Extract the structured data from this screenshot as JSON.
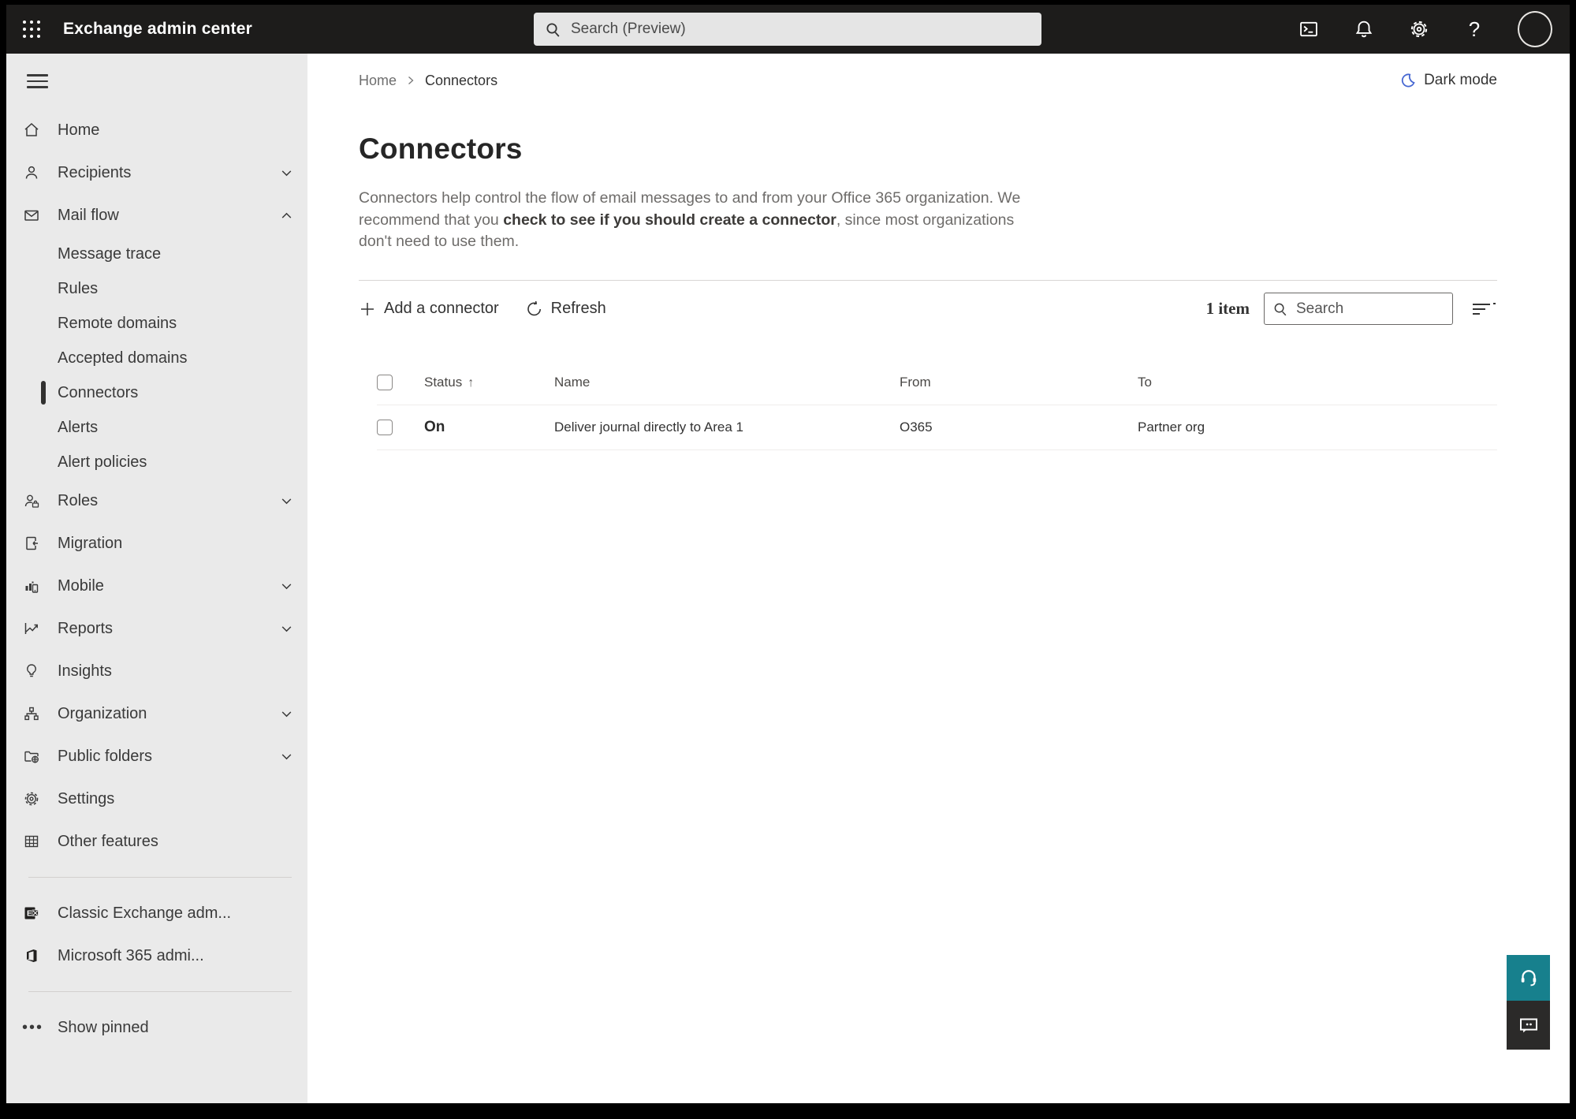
{
  "topbar": {
    "app_title": "Exchange admin center",
    "search_placeholder": "Search (Preview)",
    "icons": [
      "app-launcher-icon",
      "terminal-icon",
      "bell-icon",
      "gear-icon",
      "help-icon",
      "account-avatar"
    ]
  },
  "sidebar": {
    "items": [
      {
        "label": "Home",
        "icon": "home-icon",
        "chevron": "none"
      },
      {
        "label": "Recipients",
        "icon": "person-icon",
        "chevron": "down"
      },
      {
        "label": "Mail flow",
        "icon": "mail-icon",
        "chevron": "up",
        "children": [
          {
            "label": "Message trace"
          },
          {
            "label": "Rules"
          },
          {
            "label": "Remote domains"
          },
          {
            "label": "Accepted domains"
          },
          {
            "label": "Connectors",
            "selected": true
          },
          {
            "label": "Alerts"
          },
          {
            "label": "Alert policies"
          }
        ]
      },
      {
        "label": "Roles",
        "icon": "roles-icon",
        "chevron": "down"
      },
      {
        "label": "Migration",
        "icon": "migration-icon",
        "chevron": "none"
      },
      {
        "label": "Mobile",
        "icon": "mobile-icon",
        "chevron": "down"
      },
      {
        "label": "Reports",
        "icon": "reports-icon",
        "chevron": "down"
      },
      {
        "label": "Insights",
        "icon": "lightbulb-icon",
        "chevron": "none"
      },
      {
        "label": "Organization",
        "icon": "org-chart-icon",
        "chevron": "down"
      },
      {
        "label": "Public folders",
        "icon": "public-folder-icon",
        "chevron": "down"
      },
      {
        "label": "Settings",
        "icon": "gear-icon",
        "chevron": "none"
      },
      {
        "label": "Other features",
        "icon": "table-icon",
        "chevron": "none"
      }
    ],
    "footer": [
      {
        "label": "Classic Exchange adm...",
        "icon": "exchange-logo-icon"
      },
      {
        "label": "Microsoft 365 admi...",
        "icon": "microsoft365-logo-icon"
      }
    ],
    "show_pinned": "Show pinned"
  },
  "breadcrumb": {
    "home": "Home",
    "current": "Connectors"
  },
  "dark_mode_label": "Dark mode",
  "page": {
    "title": "Connectors",
    "description_1": "Connectors help control the flow of email messages to and from your Office 365 organization. We recommend that you ",
    "description_link": "check to see if you should create a connector",
    "description_2": ", since most organizations don't need to use them."
  },
  "toolbar": {
    "add_label": "Add a connector",
    "refresh_label": "Refresh",
    "item_count": "1 item",
    "search_placeholder": "Search"
  },
  "table": {
    "headers": {
      "status": "Status",
      "name": "Name",
      "from": "From",
      "to": "To"
    },
    "rows": [
      {
        "status": "On",
        "name": "Deliver journal directly to Area 1",
        "from": "O365",
        "to": "Partner org"
      }
    ]
  },
  "colors": {
    "topbar_bg": "#1d1c1b",
    "sidebar_bg": "#eaeaea",
    "moon_accent": "#4667d2",
    "help_button": "#17808d",
    "feedback_button": "#2b2a29"
  }
}
